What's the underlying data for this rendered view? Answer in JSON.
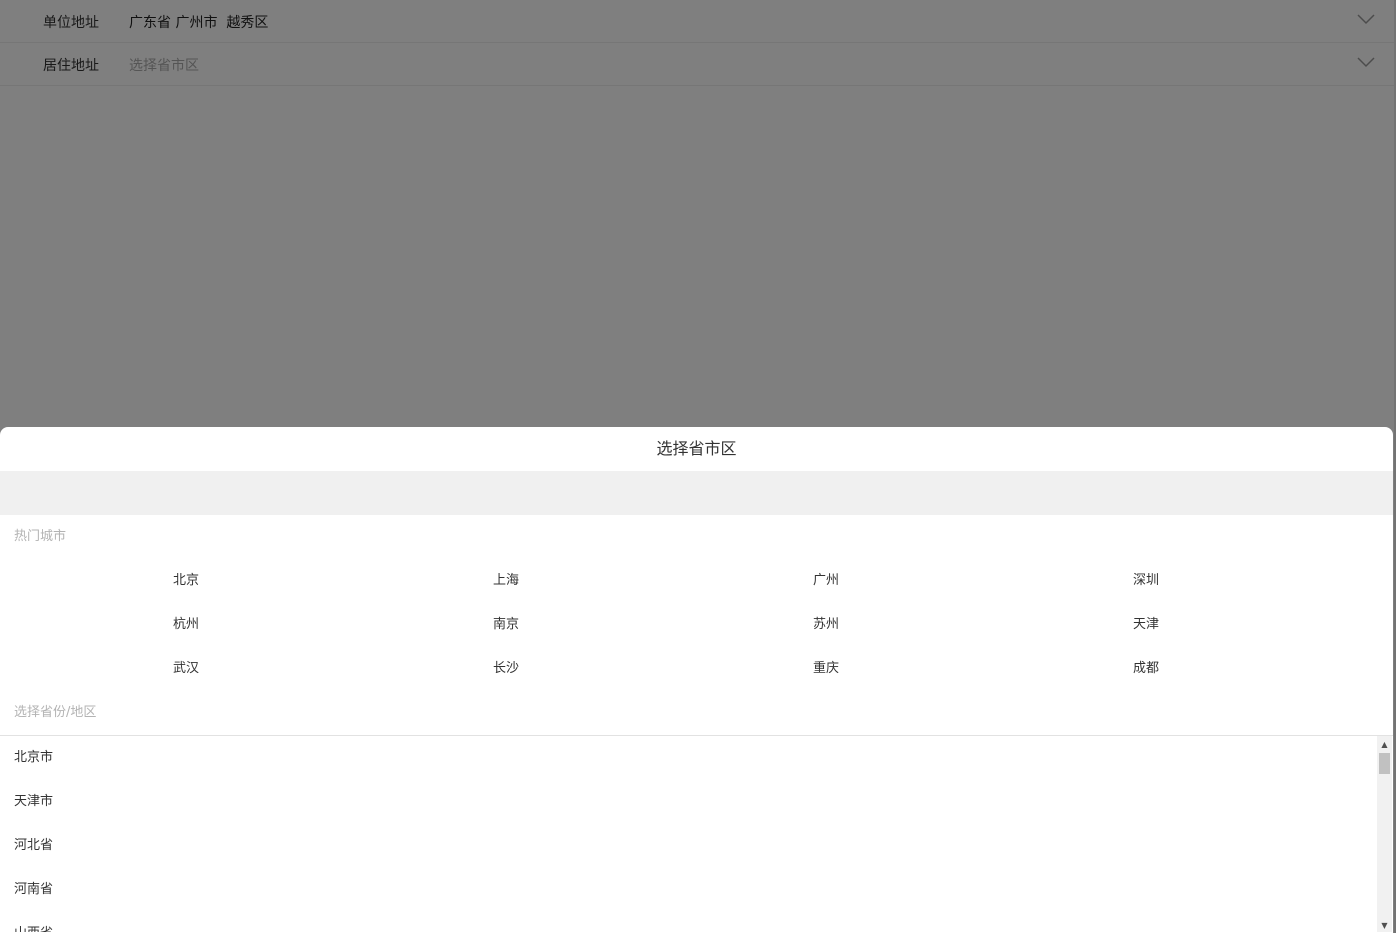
{
  "form": {
    "work_address": {
      "label": "单位地址",
      "value": "广东省 广州市  越秀区"
    },
    "home_address": {
      "label": "居住地址",
      "placeholder": "选择省市区"
    }
  },
  "picker": {
    "title": "选择省市区",
    "hot_title": "热门城市",
    "hot_cities": [
      "北京",
      "上海",
      "广州",
      "深圳",
      "杭州",
      "南京",
      "苏州",
      "天津",
      "武汉",
      "长沙",
      "重庆",
      "成都"
    ],
    "province_title": "选择省份/地区",
    "provinces": [
      "北京市",
      "天津市",
      "河北省",
      "河南省",
      "山西省"
    ]
  },
  "icons": {
    "dropdown": "chevron-down-icon",
    "scroll_up": "scroll-up-arrow",
    "scroll_down": "scroll-down-arrow"
  },
  "colors": {
    "overlay": "#808080",
    "sheet_bg": "#ffffff",
    "search_bar_bg": "#f0f0f0",
    "muted_text": "#b3b3b3"
  }
}
